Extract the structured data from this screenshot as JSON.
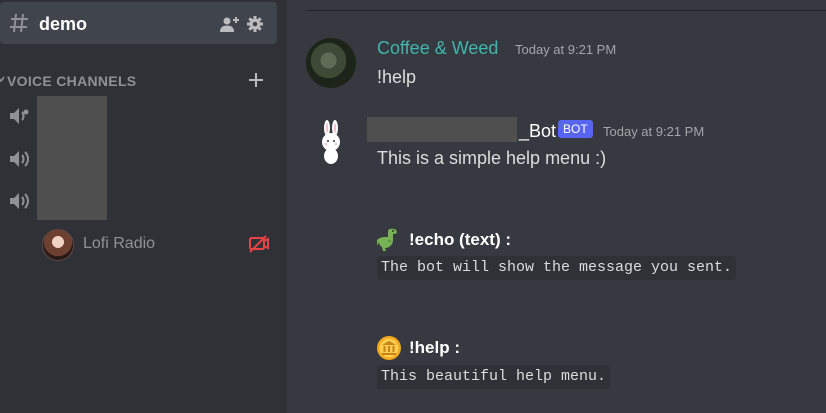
{
  "sidebar": {
    "active_channel": {
      "name": "demo",
      "icon": "hash-icon"
    },
    "voice_channels": {
      "title": "VOICE CHANNELS",
      "channels": [
        {
          "icon": "speaker-icon",
          "name_redacted": true
        },
        {
          "icon": "speaker-icon",
          "name_redacted": true
        },
        {
          "icon": "speaker-icon",
          "name_redacted": true
        }
      ],
      "member": {
        "name": "Lofi Radio",
        "status_icon": "stream-off-icon"
      }
    }
  },
  "messages": [
    {
      "author": "Coffee & Weed",
      "author_color": "#3fb7ad",
      "timestamp": "Today at 9:21 PM",
      "text": "!help"
    },
    {
      "author": "_Bot",
      "author_prefix_redacted": true,
      "tag": "BOT",
      "timestamp": "Today at 9:21 PM",
      "text": "This is a simple help menu :)",
      "commands": [
        {
          "icon": "dinosaur-icon",
          "title": "!echo (text) :",
          "description": "The bot will show the message you sent."
        },
        {
          "icon": "bank-coin-icon",
          "title": "!help :",
          "description": "This beautiful help menu."
        }
      ]
    }
  ],
  "colors": {
    "background": "#36393f",
    "sidebar": "#2f3136",
    "bot_tag": "#5865f2"
  }
}
